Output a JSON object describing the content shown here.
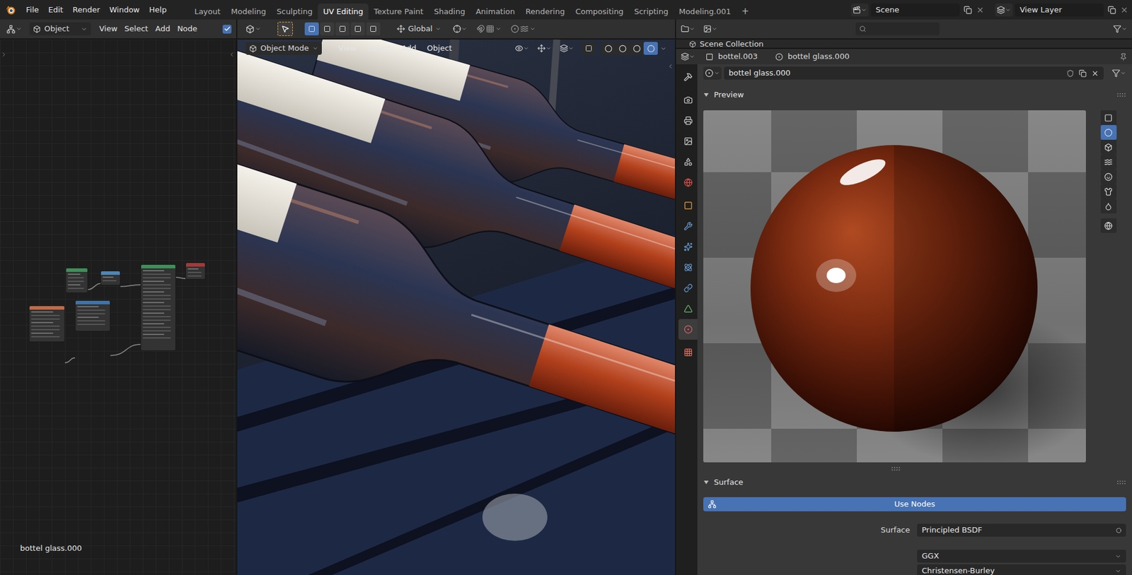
{
  "topbar": {
    "menus": [
      "File",
      "Edit",
      "Render",
      "Window",
      "Help"
    ],
    "workspaces": [
      {
        "label": "Layout",
        "selected": false
      },
      {
        "label": "Modeling",
        "selected": false
      },
      {
        "label": "Sculpting",
        "selected": false
      },
      {
        "label": "UV Editing",
        "selected": true
      },
      {
        "label": "Texture Paint",
        "selected": false
      },
      {
        "label": "Shading",
        "selected": false
      },
      {
        "label": "Animation",
        "selected": false
      },
      {
        "label": "Rendering",
        "selected": false
      },
      {
        "label": "Compositing",
        "selected": false
      },
      {
        "label": "Scripting",
        "selected": false
      },
      {
        "label": "Modeling.001",
        "selected": false
      }
    ],
    "add_workspace": "+",
    "scene": "Scene",
    "view_layer": "View Layer"
  },
  "node_editor": {
    "header": {
      "editor_mode": "Object",
      "menus": [
        "View",
        "Select",
        "Add",
        "Node"
      ],
      "use_nodes": true
    },
    "nodes": [
      {
        "color": "#3f8f58"
      },
      {
        "color": "#4f86b8"
      },
      {
        "color": "#3f8f58"
      },
      {
        "color": "#a33a3a"
      },
      {
        "color": "#c06a48"
      },
      {
        "color": "#3f74a8"
      }
    ],
    "material_label": "bottel glass.000"
  },
  "viewport": {
    "tool_header": {
      "select_modes": [
        {
          "selected": true
        },
        {
          "selected": false
        },
        {
          "selected": false
        },
        {
          "selected": false
        },
        {
          "selected": false
        }
      ],
      "orientation": "Global"
    },
    "header": {
      "mode": "Object Mode",
      "menus": [
        "View",
        "Select",
        "Add",
        "Object"
      ],
      "shading_modes": [
        {
          "selected": false
        },
        {
          "selected": false
        },
        {
          "selected": false
        },
        {
          "selected": true
        }
      ]
    }
  },
  "outliner": {
    "items": [
      "Scene Collection"
    ]
  },
  "properties": {
    "breadcrumb": {
      "object": "bottel.003",
      "material": "bottel glass.000"
    },
    "tabs": [
      {
        "selected": false
      },
      {
        "selected": false
      },
      {
        "selected": false
      },
      {
        "selected": false
      },
      {
        "selected": false
      },
      {
        "selected": false
      },
      {
        "selected": false
      },
      {
        "selected": false
      },
      {
        "selected": false
      },
      {
        "selected": false
      },
      {
        "selected": false
      },
      {
        "selected": false
      },
      {
        "selected": true
      },
      {
        "selected": false
      }
    ],
    "material_slot": "bottel glass.000",
    "preview": {
      "title": "Preview",
      "expanded": true,
      "shapes": [
        {
          "selected": false
        },
        {
          "selected": true
        },
        {
          "selected": false
        },
        {
          "selected": false
        },
        {
          "selected": false
        },
        {
          "selected": false
        },
        {
          "selected": false
        },
        {
          "selected": false
        }
      ]
    },
    "surface": {
      "title": "Surface",
      "expanded": true,
      "use_nodes_button": "Use Nodes",
      "rows": [
        {
          "label": "Surface",
          "value": "Principled BSDF",
          "kind": "socket"
        },
        {
          "value": "GGX",
          "kind": "dropdown"
        },
        {
          "value": "Christensen-Burley",
          "kind": "dropdown"
        }
      ]
    }
  }
}
